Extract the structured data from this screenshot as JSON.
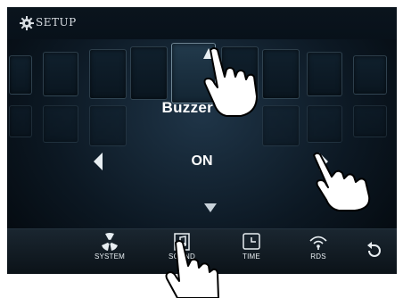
{
  "header": {
    "title": "SETUP",
    "icon": "gear-icon"
  },
  "setting": {
    "title": "Buzzer Set",
    "value": "ON"
  },
  "tabs": [
    {
      "label": "SYSTEM",
      "icon": "fan-icon"
    },
    {
      "label": "SOUND",
      "icon": "music-note-icon"
    },
    {
      "label": "TIME",
      "icon": "clock-icon"
    },
    {
      "label": "RDS",
      "icon": "radio-signal-icon"
    }
  ],
  "back": {
    "icon": "back-icon"
  },
  "colors": {
    "background": "#0c1823",
    "text": "#ffffff",
    "hand": "#ffffff"
  }
}
